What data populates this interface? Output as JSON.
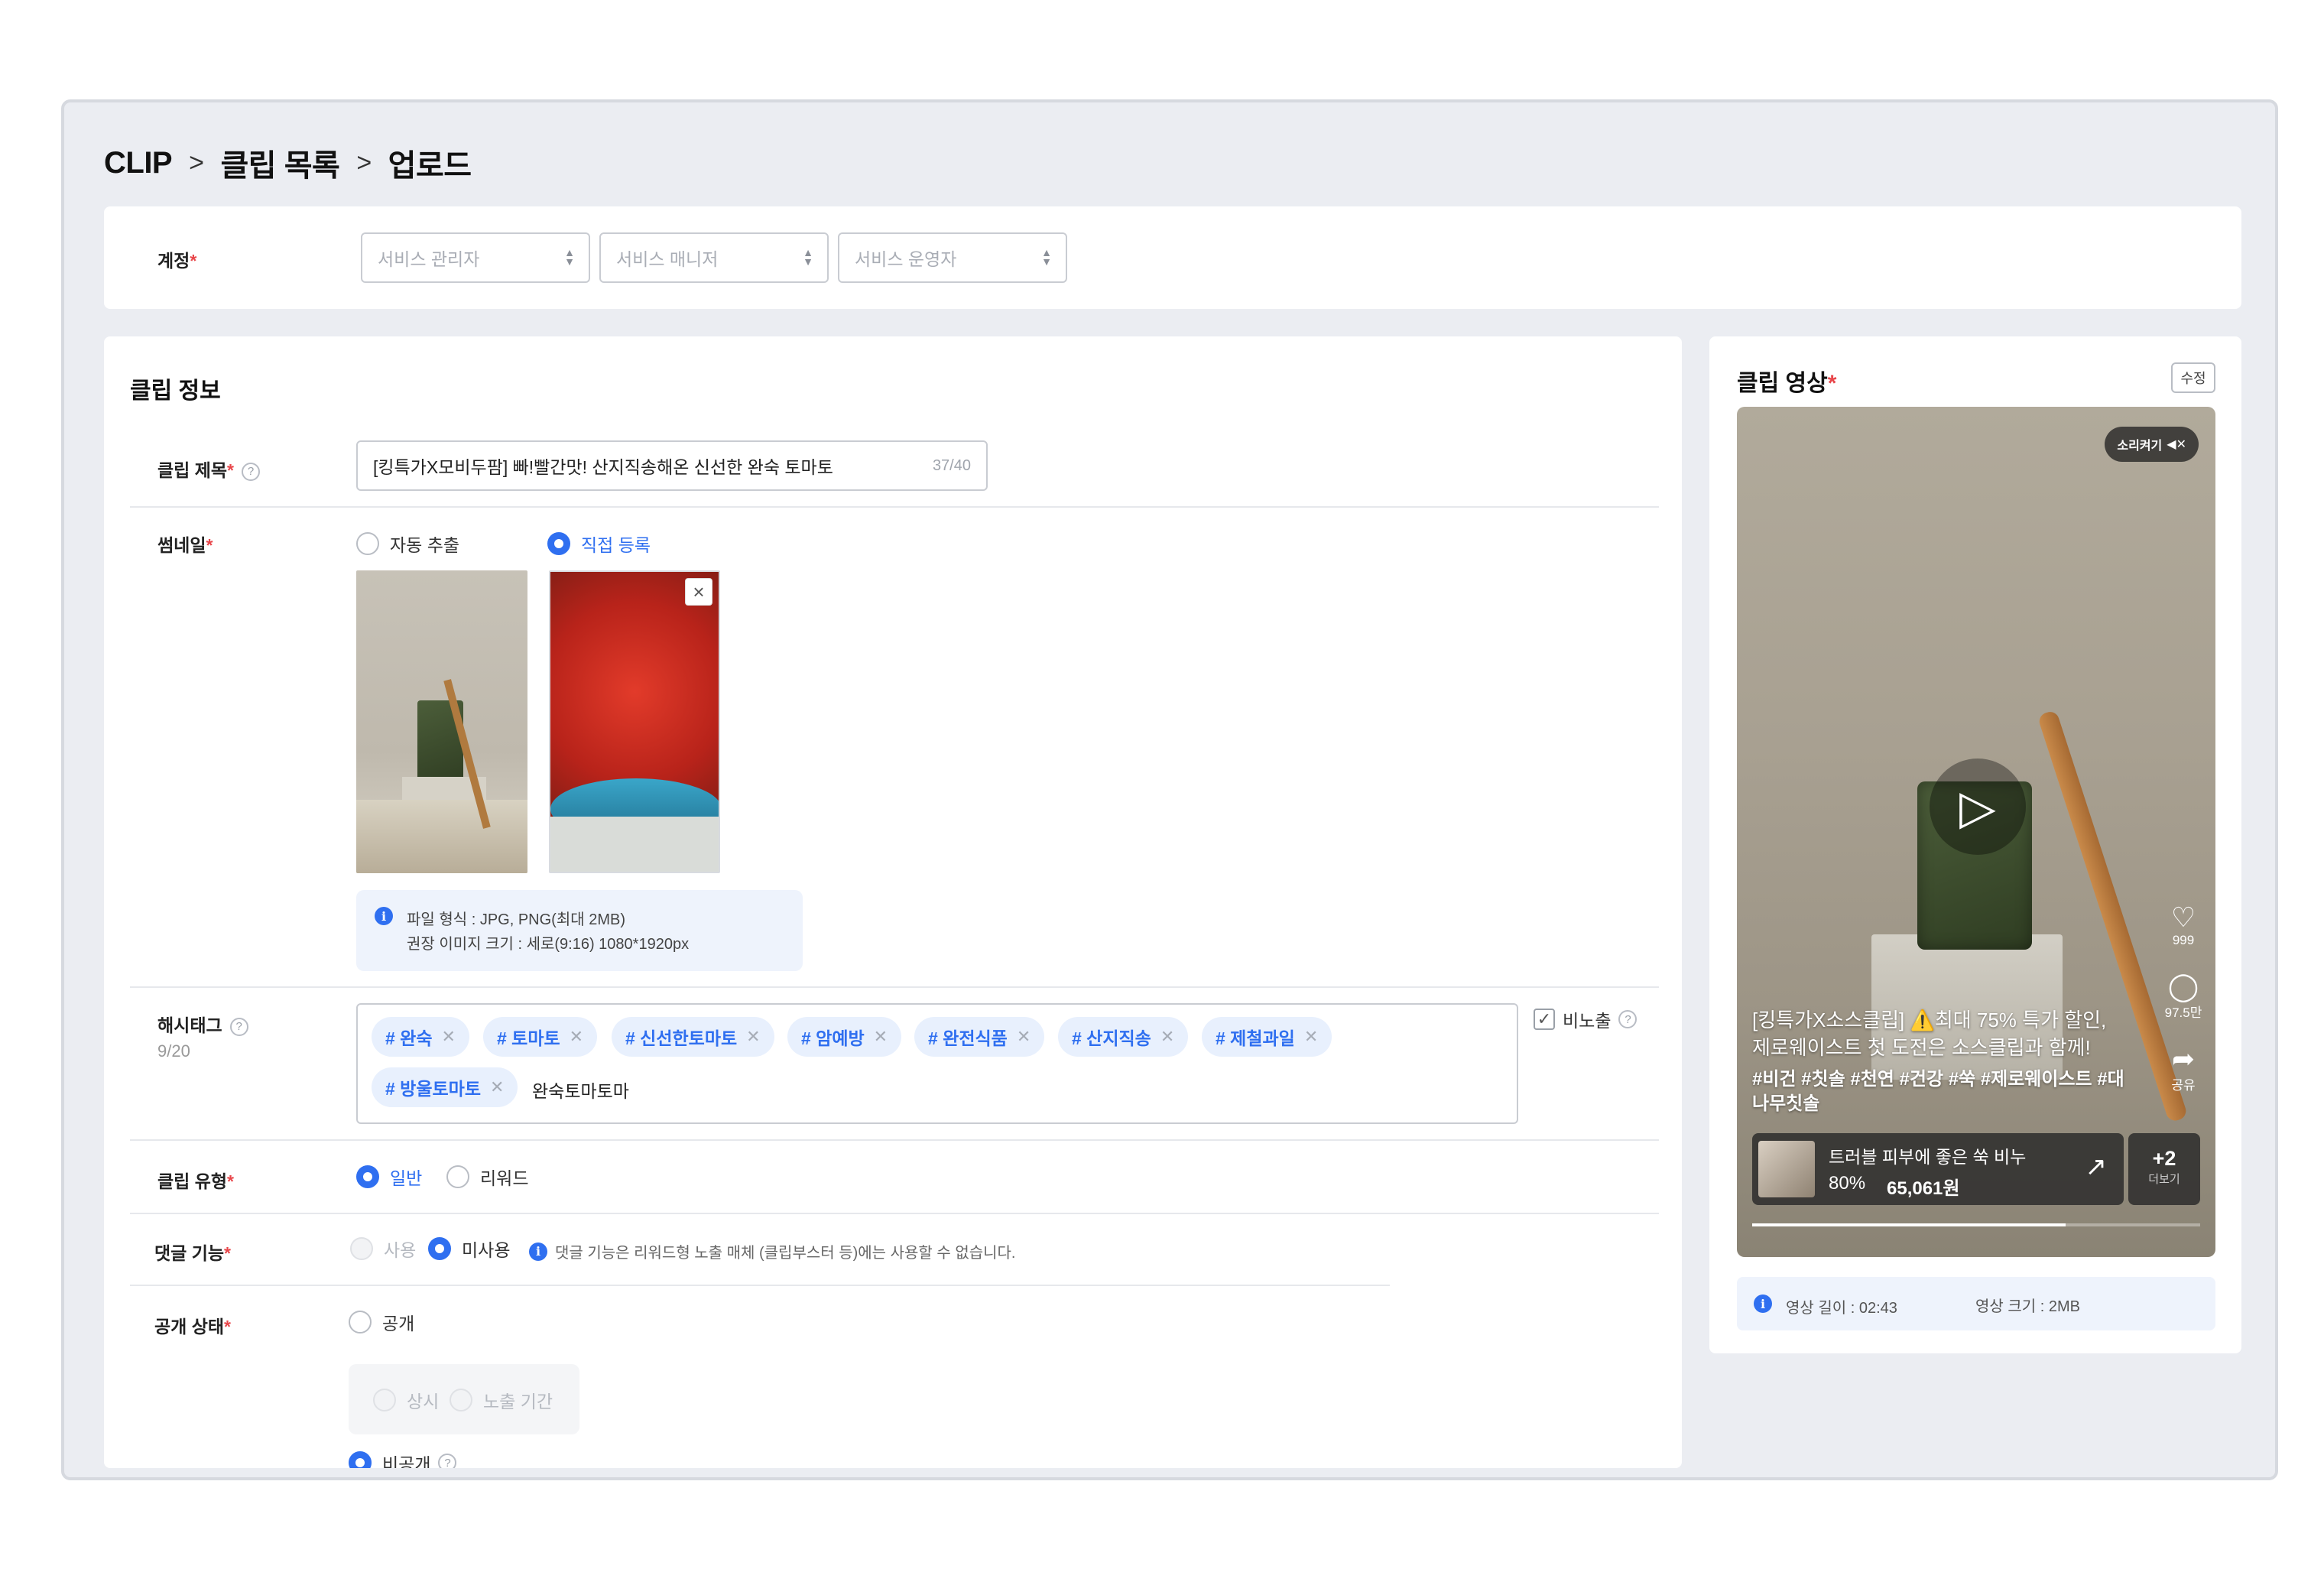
{
  "breadcrumb": {
    "root": "CLIP",
    "list": "클립 목록",
    "current": "업로드",
    "sep": ">"
  },
  "account": {
    "label": "계정",
    "required": "*",
    "selects": [
      {
        "placeholder": "서비스 관리자"
      },
      {
        "placeholder": "서비스 매니저"
      },
      {
        "placeholder": "서비스 운영자"
      }
    ]
  },
  "clip_info": {
    "section_title": "클립 정보",
    "title_field": {
      "label": "클립 제목",
      "required": "*",
      "value": "[킹특가X모비두팜] 빠!빨간맛! 산지직송해온 신선한 완숙 토마토",
      "counter": "37/40"
    },
    "thumbnail": {
      "label": "썸네일",
      "required": "*",
      "options": [
        "자동 추출",
        "직접 등록"
      ],
      "selected": "직접 등록",
      "notice_line1": "파일 형식 : JPG, PNG(최대 2MB)",
      "notice_line2": "권장 이미지 크기 : 세로(9:16) 1080*1920px"
    },
    "hashtag": {
      "label": "해시태그",
      "count": "9/20",
      "tags": [
        "# 완숙",
        "# 토마토",
        "# 신선한토마토",
        "# 암예방",
        "# 완전식품",
        "# 산지직송",
        "# 제철과일",
        "# 방울토마토"
      ],
      "typing": "완숙토마토마",
      "hide_label": "비노출",
      "hide_checked": true
    },
    "clip_type": {
      "label": "클립 유형",
      "required": "*",
      "options": [
        "일반",
        "리워드"
      ],
      "selected": "일반"
    },
    "comments": {
      "label": "댓글 기능",
      "required": "*",
      "options": [
        "사용",
        "미사용"
      ],
      "selected": "미사용",
      "note": "댓글 기능은 리워드형 노출 매체 (클립부스터 등)에는 사용할 수 없습니다."
    },
    "visibility": {
      "label": "공개 상태",
      "required": "*",
      "public_label": "공개",
      "sub_options": [
        "상시",
        "노출 기간"
      ],
      "private_label": "비공개",
      "selected": "비공개"
    }
  },
  "clip_video": {
    "title": "클립 영상",
    "required": "*",
    "edit_label": "수정",
    "sound_label": "소리켜기",
    "caption": "[킹특가X소스클립] ⚠️최대 75% 특가 할인, 제로웨이스트 첫 도전은 소스클립과 함께!",
    "tags": "#비건 #칫솔 #천연 #건강 #쑥 #제로웨이스트 #대나무칫솔",
    "likes": "999",
    "comments": "97.5만",
    "share": "공유",
    "product_name": "트러블 피부에 좋은 쑥 비누",
    "product_discount": "80%",
    "product_price": "65,061원",
    "more_count": "+2",
    "more_label": "더보기",
    "progress": 0.7,
    "length_label": "영상 길이 : 02:43",
    "size_label": "영상 크기 : 2MB"
  },
  "colors": {
    "accent": "#2f6ff0",
    "required": "#e8464a",
    "tag_bg": "#e8f0fd",
    "frame_bg": "#ebedf2"
  }
}
